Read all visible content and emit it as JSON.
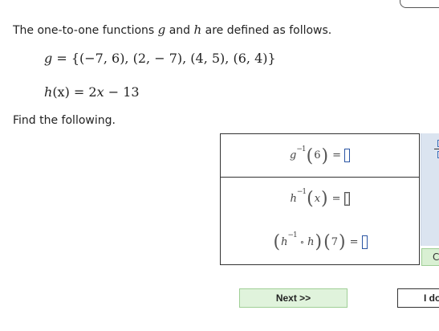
{
  "problem": {
    "intro_before": "The one-to-one functions ",
    "g": "g",
    "and": " and ",
    "h": "h",
    "intro_after": " are defined as follows.",
    "g_name": "g",
    "g_set": " = {(−7, 6), (2, − 7), (4, 5), (6,  4)}",
    "h_lhs_name": "h",
    "h_lhs_arg": "(x)",
    "h_rhs_eq": " = 2",
    "h_rhs_var": "x",
    "h_rhs_rest": " − 13",
    "find_text": "Find the following."
  },
  "answers": {
    "row1": {
      "fn": "g",
      "sup": "−1",
      "arg": "6",
      "eq": "="
    },
    "row2": {
      "fn": "h",
      "sup": "−1",
      "arg": "x",
      "eq": "="
    },
    "row3": {
      "fn1": "h",
      "sup": "−1",
      "op": "∘",
      "fn2": "h",
      "arg": "7",
      "eq": "="
    }
  },
  "side": {
    "button_label": "C"
  },
  "buttons": {
    "next_label": "Next >>",
    "idk_label": "I don't know"
  },
  "colors": {
    "input_border": "#2a55a3",
    "next_bg": "#e0f3dc",
    "side_panel_bg": "#dbe4f0"
  }
}
